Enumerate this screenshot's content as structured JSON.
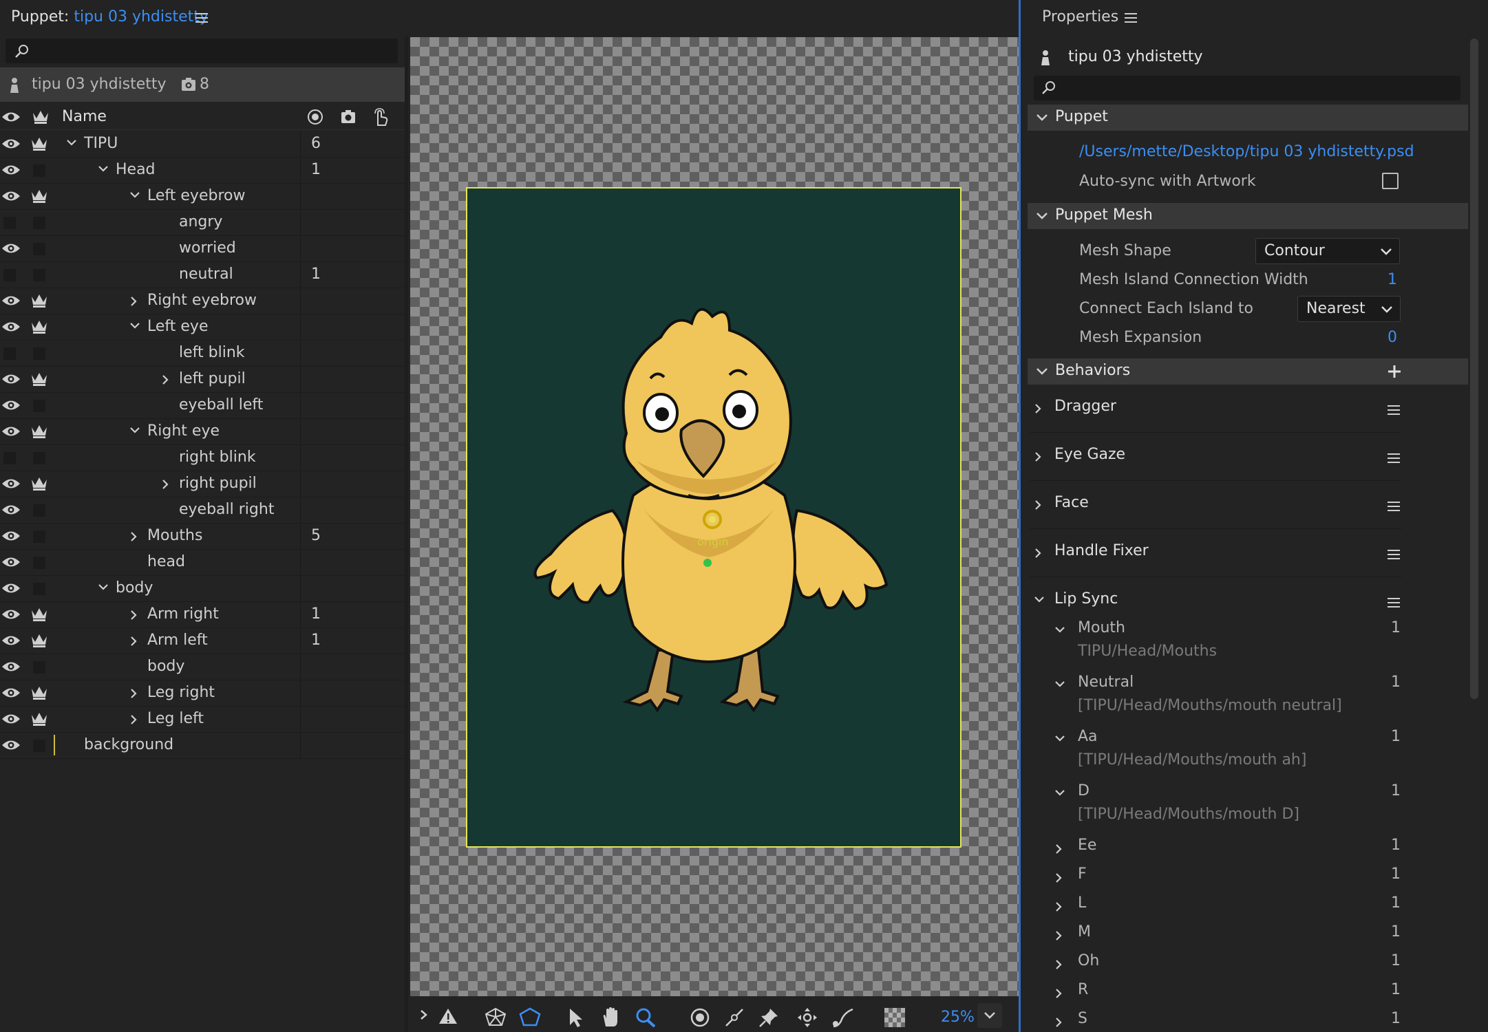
{
  "left_panel": {
    "title_prefix": "Puppet:",
    "title_name": "tipu 03 yhdistetty",
    "puppet_name": "tipu 03 yhdistetty",
    "camera_count": "8",
    "column_name": "Name",
    "layers": [
      {
        "label": "TIPU",
        "indent": 0,
        "chevron": "down",
        "eye": true,
        "crown": true,
        "num": "6"
      },
      {
        "label": "Head",
        "indent": 1,
        "chevron": "down",
        "eye": true,
        "crown": false,
        "num": "1"
      },
      {
        "label": "Left eyebrow",
        "indent": 2,
        "chevron": "down",
        "eye": true,
        "crown": true,
        "num": ""
      },
      {
        "label": "angry",
        "indent": 3,
        "chevron": "none",
        "eye": false,
        "crown": false,
        "num": ""
      },
      {
        "label": "worried",
        "indent": 3,
        "chevron": "none",
        "eye": true,
        "crown": false,
        "num": ""
      },
      {
        "label": "neutral",
        "indent": 3,
        "chevron": "none",
        "eye": false,
        "crown": false,
        "num": "1"
      },
      {
        "label": "Right eyebrow",
        "indent": 2,
        "chevron": "right",
        "eye": true,
        "crown": true,
        "num": ""
      },
      {
        "label": "Left eye",
        "indent": 2,
        "chevron": "down",
        "eye": true,
        "crown": true,
        "num": ""
      },
      {
        "label": "left blink",
        "indent": 3,
        "chevron": "none",
        "eye": false,
        "crown": false,
        "num": ""
      },
      {
        "label": "left pupil",
        "indent": 3,
        "chevron": "right",
        "eye": true,
        "crown": true,
        "num": ""
      },
      {
        "label": "eyeball left",
        "indent": 3,
        "chevron": "none",
        "eye": true,
        "crown": false,
        "num": ""
      },
      {
        "label": "Right eye",
        "indent": 2,
        "chevron": "down",
        "eye": true,
        "crown": true,
        "num": ""
      },
      {
        "label": "right blink",
        "indent": 3,
        "chevron": "none",
        "eye": false,
        "crown": false,
        "num": ""
      },
      {
        "label": "right pupil",
        "indent": 3,
        "chevron": "right",
        "eye": true,
        "crown": true,
        "num": ""
      },
      {
        "label": "eyeball right",
        "indent": 3,
        "chevron": "none",
        "eye": true,
        "crown": false,
        "num": ""
      },
      {
        "label": "Mouths",
        "indent": 2,
        "chevron": "right",
        "eye": true,
        "crown": false,
        "num": "5"
      },
      {
        "label": "head",
        "indent": 2,
        "chevron": "none",
        "eye": true,
        "crown": false,
        "num": ""
      },
      {
        "label": "body",
        "indent": 1,
        "chevron": "down",
        "eye": true,
        "crown": false,
        "num": ""
      },
      {
        "label": "Arm right",
        "indent": 2,
        "chevron": "right",
        "eye": true,
        "crown": true,
        "num": "1"
      },
      {
        "label": "Arm left",
        "indent": 2,
        "chevron": "right",
        "eye": true,
        "crown": true,
        "num": "1"
      },
      {
        "label": "body",
        "indent": 2,
        "chevron": "none",
        "eye": true,
        "crown": false,
        "num": ""
      },
      {
        "label": "Leg right",
        "indent": 2,
        "chevron": "right",
        "eye": true,
        "crown": true,
        "num": ""
      },
      {
        "label": "Leg left",
        "indent": 2,
        "chevron": "right",
        "eye": true,
        "crown": true,
        "num": ""
      },
      {
        "label": "background",
        "indent": 0,
        "chevron": "none",
        "eye": true,
        "crown": false,
        "num": "",
        "selected": true
      }
    ]
  },
  "stage": {
    "origin_label": "origin",
    "zoom": "25%",
    "artboard_color": "#163832",
    "artboard_border": "#e5e55a"
  },
  "properties": {
    "title": "Properties",
    "puppet_name": "tipu 03 yhdistetty",
    "sections": {
      "puppet": "Puppet",
      "mesh": "Puppet Mesh",
      "behaviors": "Behaviors"
    },
    "file_path": "/Users/mette/Desktop/tipu 03 yhdistetty.psd",
    "auto_sync_label": "Auto-sync with Artwork",
    "auto_sync_checked": false,
    "mesh_shape_label": "Mesh Shape",
    "mesh_shape_value": "Contour",
    "island_width_label": "Mesh Island Connection Width",
    "island_width_value": "1",
    "connect_label": "Connect Each Island to",
    "connect_value": "Nearest",
    "expansion_label": "Mesh Expansion",
    "expansion_value": "0",
    "behaviors": [
      "Dragger",
      "Eye Gaze",
      "Face",
      "Handle Fixer",
      "Lip Sync"
    ],
    "lip_sync": [
      {
        "label": "Mouth",
        "expanded": true,
        "num": "1",
        "sub": "TIPU/Head/Mouths"
      },
      {
        "label": "Neutral",
        "expanded": true,
        "num": "1",
        "sub": "[TIPU/Head/Mouths/mouth neutral]"
      },
      {
        "label": "Aa",
        "expanded": true,
        "num": "1",
        "sub": "[TIPU/Head/Mouths/mouth ah]"
      },
      {
        "label": "D",
        "expanded": true,
        "num": "1",
        "sub": "[TIPU/Head/Mouths/mouth D]"
      },
      {
        "label": "Ee",
        "expanded": false,
        "num": "1"
      },
      {
        "label": "F",
        "expanded": false,
        "num": "1"
      },
      {
        "label": "L",
        "expanded": false,
        "num": "1"
      },
      {
        "label": "M",
        "expanded": false,
        "num": "1"
      },
      {
        "label": "Oh",
        "expanded": false,
        "num": "1"
      },
      {
        "label": "R",
        "expanded": false,
        "num": "1"
      },
      {
        "label": "S",
        "expanded": false,
        "num": "1"
      }
    ]
  },
  "colors": {
    "accent": "#3a8ff5",
    "panel": "#232323",
    "section": "#383838"
  }
}
